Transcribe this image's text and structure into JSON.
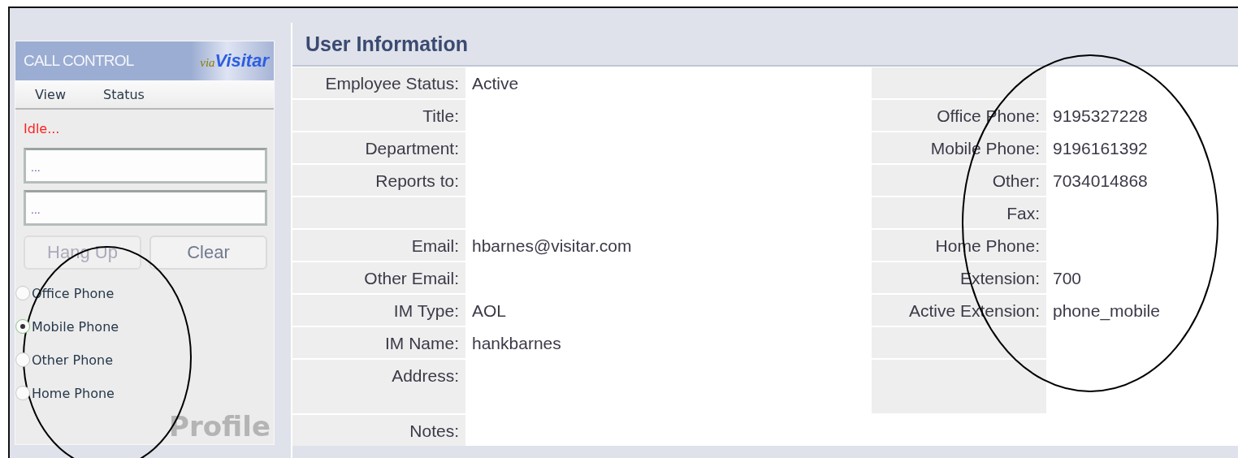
{
  "call_control": {
    "title": "CALL CONTROL",
    "logo": {
      "prefix": "via",
      "name": "Visitar"
    },
    "menu": [
      "View",
      "Status"
    ],
    "status": "Idle...",
    "fields": [
      {
        "value": "..."
      },
      {
        "value": "..."
      }
    ],
    "buttons": [
      {
        "label": "Hang Up",
        "disabled": true
      },
      {
        "label": "Clear",
        "disabled": false
      }
    ],
    "phones": [
      {
        "label": "Office Phone",
        "selected": false
      },
      {
        "label": "Mobile Phone",
        "selected": true
      },
      {
        "label": "Other Phone",
        "selected": false
      },
      {
        "label": "Home Phone",
        "selected": false
      }
    ],
    "footer": "Profile"
  },
  "user_information": {
    "title": "User Information",
    "rows": [
      {
        "left_label": "Employee Status:",
        "left_value": "Active"
      },
      {
        "left_label": "Title:",
        "right_label": "Office Phone:",
        "right_value": "9195327228"
      },
      {
        "left_label": "Department:",
        "right_label": "Mobile Phone:",
        "right_value": "9196161392"
      },
      {
        "left_label": "Reports to:",
        "right_label": "Other:",
        "right_value": "7034014868"
      },
      {
        "right_label": "Fax:"
      },
      {
        "left_label": "Email:",
        "left_value": "hbarnes@visitar.com",
        "right_label": "Home Phone:"
      },
      {
        "left_label": "Other Email:",
        "right_label": "Extension:",
        "right_value": "700"
      },
      {
        "left_label": "IM Type:",
        "left_value": "AOL",
        "right_label": "Active Extension:",
        "right_value": "phone_mobile"
      },
      {
        "left_label": "IM Name:",
        "left_value": "hankbarnes"
      },
      {
        "left_label": "Address:",
        "tall": true
      },
      {
        "left_label": "Notes:",
        "right_empty": true
      }
    ]
  },
  "annotation_ovals": [
    {
      "kind": "oval"
    },
    {
      "kind": "oval"
    }
  ]
}
